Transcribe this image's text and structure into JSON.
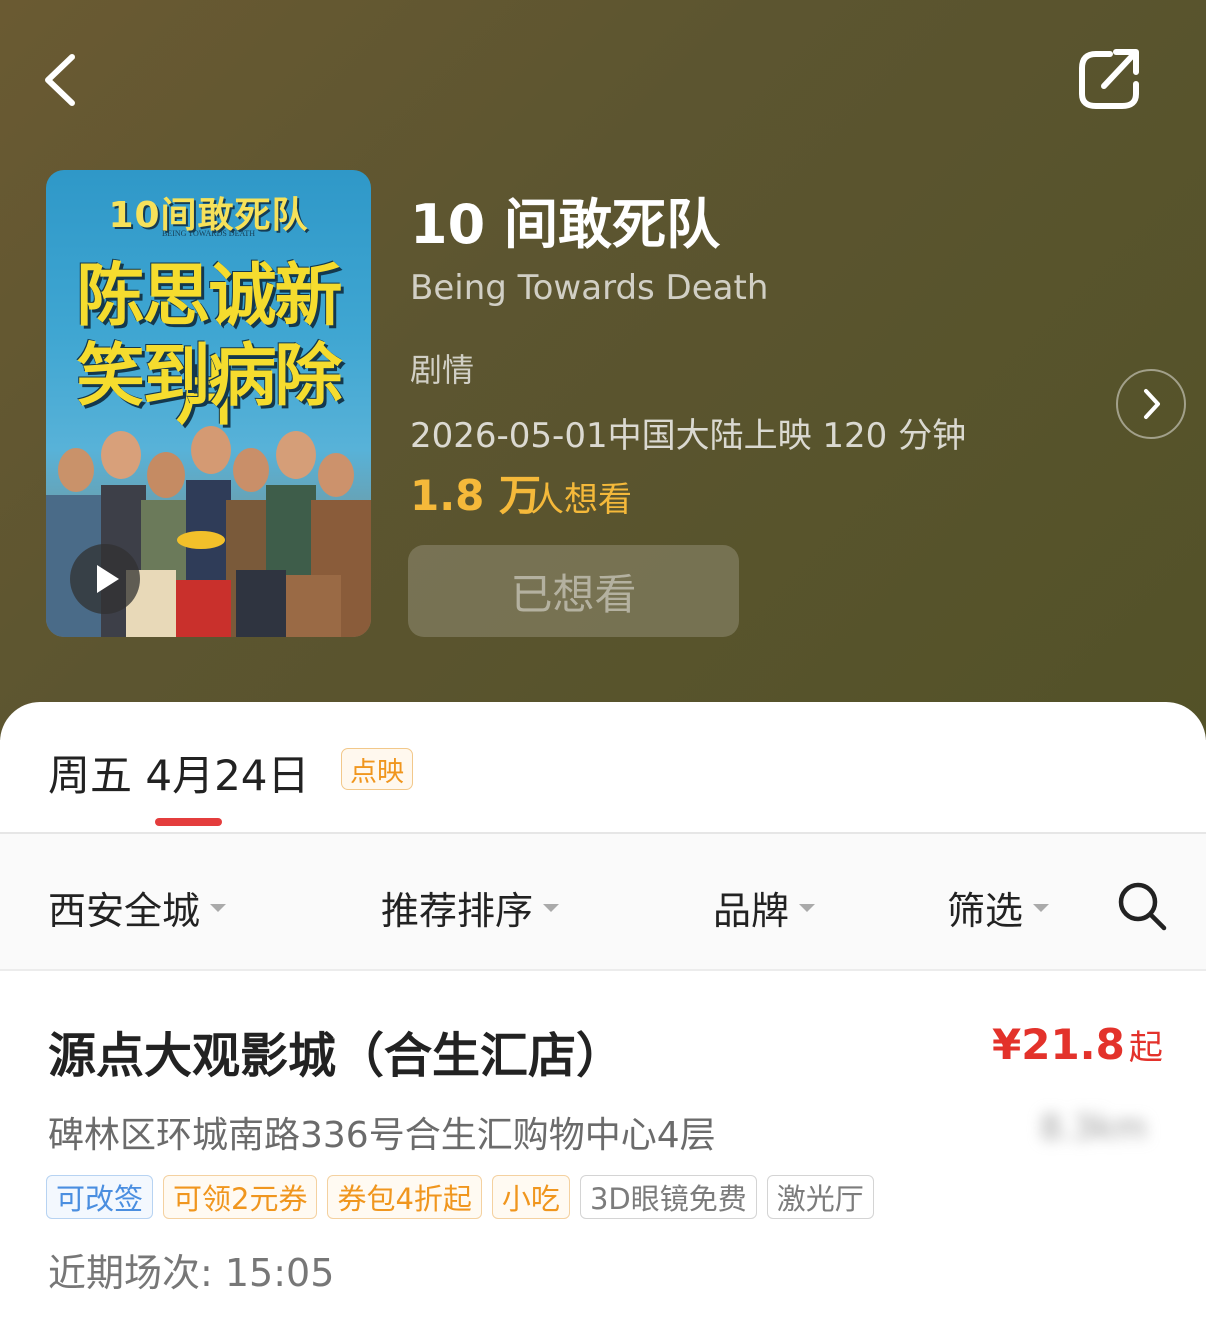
{
  "header": {
    "back_icon": "chevron-left-icon",
    "share_icon": "share-icon"
  },
  "movie": {
    "poster": {
      "logo_text": "10间敢死队",
      "logo_sub": "BEING TOWARDS DEATH",
      "tagline_1": "陈思诚新片",
      "tagline_2": "笑到病除"
    },
    "title": "10 间敢死队",
    "title_en": "Being Towards Death",
    "genre": "剧情",
    "release": "2026-05-01中国大陆上映 120 分钟",
    "want_count": "1.8 万",
    "want_label": "人想看",
    "want_button": "已想看",
    "accent_color": "#f5b93a"
  },
  "schedule": {
    "date_tab": "周五 4月24日",
    "date_badge": "点映",
    "underline_color": "#e43d3d"
  },
  "filters": [
    {
      "label": "西安全城"
    },
    {
      "label": "推荐排序"
    },
    {
      "label": "品牌"
    },
    {
      "label": "筛选"
    }
  ],
  "cinema": {
    "name": "源点大观影城（合生汇店）",
    "price": "¥21.8",
    "price_suffix": "起",
    "price_color": "#e3322b",
    "address": "碑林区环城南路336号合生汇购物中心4层",
    "distance": "8.3km",
    "tags": [
      {
        "label": "可改签",
        "style": "blue"
      },
      {
        "label": "可领2元券",
        "style": "orange"
      },
      {
        "label": "券包4折起",
        "style": "orange"
      },
      {
        "label": "小吃",
        "style": "orange"
      },
      {
        "label": "3D眼镜免费",
        "style": "gray"
      },
      {
        "label": "激光厅",
        "style": "gray"
      }
    ],
    "recent_showtime": "近期场次: 15:05"
  }
}
